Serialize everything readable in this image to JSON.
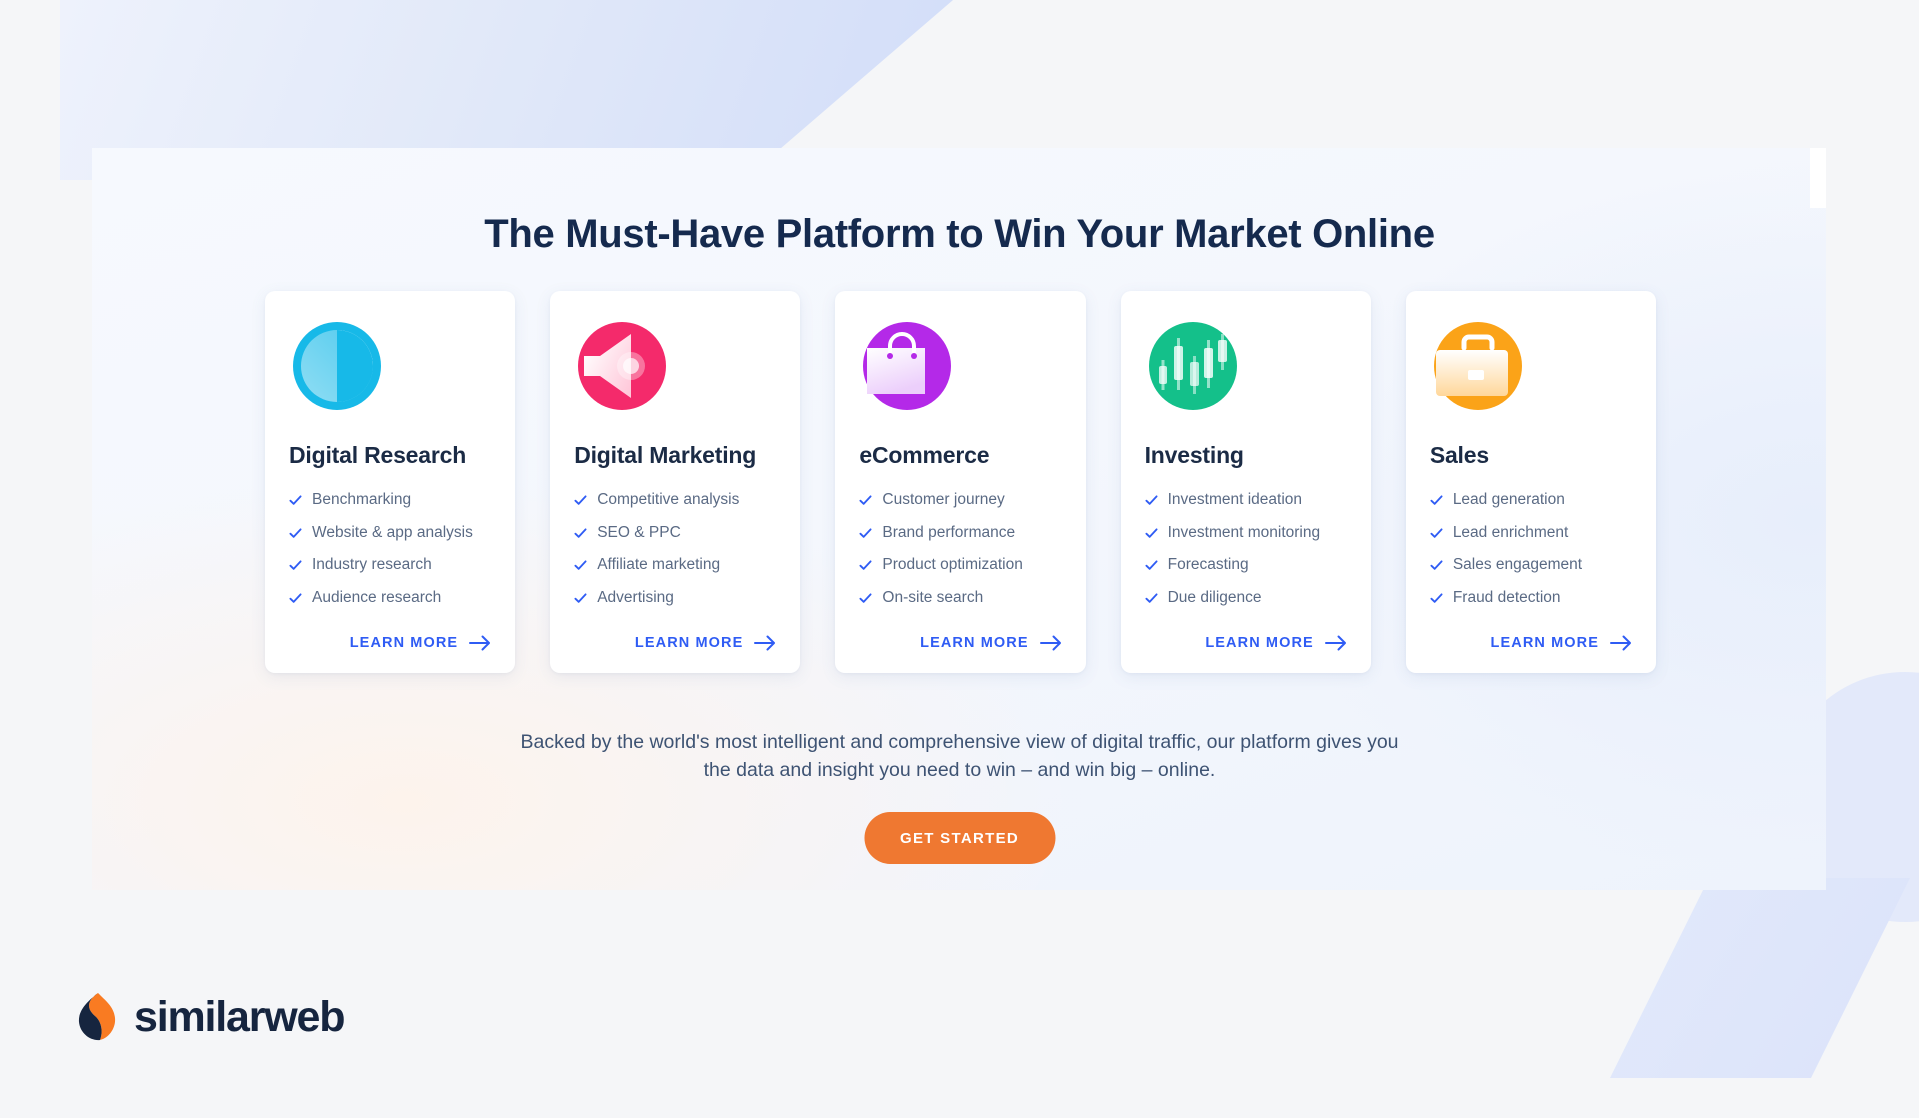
{
  "headline": "The Must-Have Platform to Win Your Market Online",
  "cards": [
    {
      "icon": "pie-chart-icon",
      "icon_color": "#17b9e8",
      "title": "Digital Research",
      "features": [
        "Benchmarking",
        "Website & app analysis",
        "Industry research",
        "Audience research"
      ],
      "link_label": "LEARN MORE"
    },
    {
      "icon": "megaphone-icon",
      "icon_color": "#f42a6b",
      "title": "Digital Marketing",
      "features": [
        "Competitive analysis",
        "SEO & PPC",
        "Affiliate marketing",
        "Advertising"
      ],
      "link_label": "LEARN MORE"
    },
    {
      "icon": "shopping-bag-icon",
      "icon_color": "#b429e8",
      "title": "eCommerce",
      "features": [
        "Customer journey",
        "Brand performance",
        "Product optimization",
        "On-site search"
      ],
      "link_label": "LEARN MORE"
    },
    {
      "icon": "candlestick-chart-icon",
      "icon_color": "#14c08a",
      "title": "Investing",
      "features": [
        "Investment ideation",
        "Investment monitoring",
        "Forecasting",
        "Due diligence"
      ],
      "link_label": "LEARN MORE"
    },
    {
      "icon": "briefcase-icon",
      "icon_color": "#fba318",
      "title": "Sales",
      "features": [
        "Lead generation",
        "Lead enrichment",
        "Sales engagement",
        "Fraud detection"
      ],
      "link_label": "LEARN MORE"
    }
  ],
  "sub_copy": "Backed by the world's most intelligent and comprehensive view of digital traffic, our platform gives you the data and insight you need to win – and win big – online.",
  "cta_label": "GET STARTED",
  "logo": {
    "text": "similarweb"
  },
  "colors": {
    "accent_blue": "#2f5cf4",
    "cta_orange": "#ef7831",
    "headline_navy": "#152a4e",
    "body_gray": "#5a6a84",
    "logo_navy": "#16253f",
    "logo_orange": "#f97b22"
  }
}
